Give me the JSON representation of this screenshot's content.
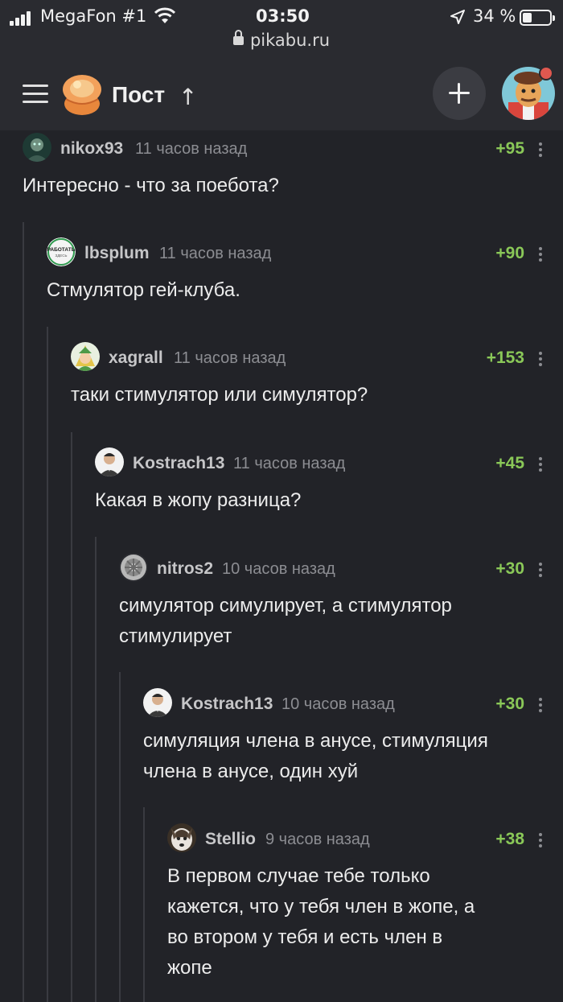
{
  "status_bar": {
    "carrier": "MegaFon #1",
    "time": "03:50",
    "battery_percent": "34 %",
    "battery_level": 0.34,
    "url": "pikabu.ru"
  },
  "header": {
    "title": "Пост",
    "up_arrow": "↑",
    "menu_icon": "hamburger-menu-icon",
    "add_icon": "plus-icon",
    "notification_color": "#e0584f"
  },
  "colors": {
    "background": "#222328",
    "header": "#2a2b30",
    "rating_positive": "#8ac858",
    "muted_text": "#8c8d92"
  },
  "comments": [
    {
      "user": "nikox93",
      "time": "11 часов назад",
      "rating": "+95",
      "text": [
        "Интересно - что за поебота?"
      ]
    },
    {
      "user": "lbsplum",
      "time": "11 часов назад",
      "rating": "+90",
      "text": [
        "Стмулятор гей-клуба."
      ],
      "avatar_text": [
        "РАБОТАТЬ",
        "ЗДЕСЬ"
      ]
    },
    {
      "user": "xagrall",
      "time": "11 часов назад",
      "rating": "+153",
      "text": [
        "таки стимулятор или симулятор?"
      ]
    },
    {
      "user": "Kostrach13",
      "time": "11 часов назад",
      "rating": "+45",
      "text": [
        "Какая в жопу разница?"
      ]
    },
    {
      "user": "nitros2",
      "time": "10 часов назад",
      "rating": "+30",
      "text": [
        "симулятор симулирует, а стимулятор",
        "стимулирует"
      ]
    },
    {
      "user": "Kostrach13",
      "time": "10 часов назад",
      "rating": "+30",
      "text": [
        "симуляция члена в анусе, стимуляция",
        "члена в анусе, один хуй"
      ]
    },
    {
      "user": "Stellio",
      "time": "9 часов назад",
      "rating": "+38",
      "text": [
        "В первом случае тебе только",
        "кажется, что у тебя член в жопе, а",
        "во втором у тебя и есть член в",
        "жопе"
      ]
    }
  ]
}
